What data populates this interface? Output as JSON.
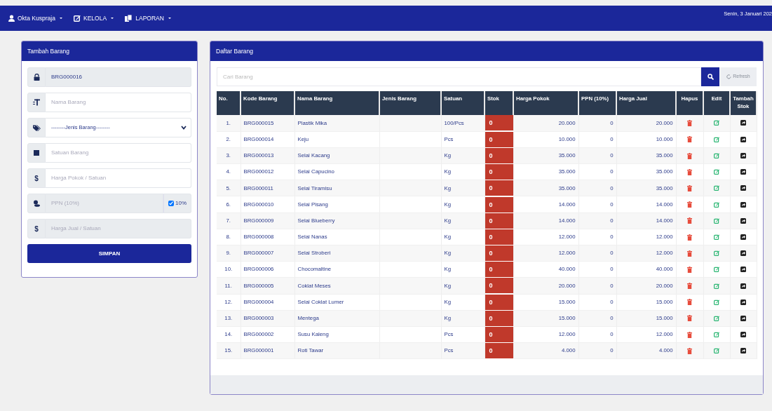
{
  "navbar": {
    "menus": [
      {
        "label": "Okta Kuspraja"
      },
      {
        "label": "KELOLA"
      },
      {
        "label": "LAPORAN"
      }
    ],
    "date": "Senin, 3 Januari 202"
  },
  "form_card": {
    "title": "Tambah Barang",
    "fields": [
      {
        "kind": "text",
        "value": "BRG000016",
        "readonly": true
      },
      {
        "kind": "text",
        "placeholder": "Nama Barang",
        "readonly": false
      },
      {
        "kind": "select",
        "value": "--------Jenis Barang--------"
      },
      {
        "kind": "text",
        "placeholder": "Satuan Barang",
        "readonly": false
      },
      {
        "kind": "text",
        "icon_char": "$",
        "placeholder": "Harga Pokok / Satuan",
        "readonly": false
      },
      {
        "kind": "ppn",
        "placeholder": "PPN (10%)",
        "readonly": true,
        "checked": true,
        "check_label": "10%"
      },
      {
        "kind": "text",
        "icon_char": "$",
        "placeholder": "Harga Jual / Satuan",
        "readonly": true
      }
    ],
    "submit": "SIMPAN"
  },
  "list_card": {
    "title": "Daftar Barang",
    "search": {
      "placeholder": "Cari Barang"
    },
    "refresh": {
      "label": "Refresh",
      "disabled": true
    },
    "table": {
      "columns": [
        "No.",
        "Kode Barang",
        "Nama Barang",
        "Jenis Barang",
        "Satuan",
        "Stok",
        "Harga Pokok",
        "PPN (10%)",
        "Harga Jual",
        "Hapus",
        "Edit",
        "Tambah Stok"
      ],
      "rows": [
        {
          "no": "1.",
          "code": "BRG000015",
          "name": "Plastik Mika",
          "unit": "100/Pcs",
          "stock": "0",
          "price": "20.000",
          "ppn": "0",
          "sell": "20.000"
        },
        {
          "no": "2.",
          "code": "BRG000014",
          "name": "Keju",
          "unit": "Pcs",
          "stock": "0",
          "price": "10.000",
          "ppn": "0",
          "sell": "10.000"
        },
        {
          "no": "3.",
          "code": "BRG000013",
          "name": "Selai Kacang",
          "unit": "Kg",
          "stock": "0",
          "price": "35.000",
          "ppn": "0",
          "sell": "35.000"
        },
        {
          "no": "4.",
          "code": "BRG000012",
          "name": "Selai Capucino",
          "unit": "Kg",
          "stock": "0",
          "price": "35.000",
          "ppn": "0",
          "sell": "35.000"
        },
        {
          "no": "5.",
          "code": "BRG000011",
          "name": "Selai Tiramisu",
          "unit": "Kg",
          "stock": "0",
          "price": "35.000",
          "ppn": "0",
          "sell": "35.000"
        },
        {
          "no": "6.",
          "code": "BRG000010",
          "name": "Selai Pisang",
          "unit": "Kg",
          "stock": "0",
          "price": "14.000",
          "ppn": "0",
          "sell": "14.000"
        },
        {
          "no": "7.",
          "code": "BRG000009",
          "name": "Selai Blueberry",
          "unit": "Kg",
          "stock": "0",
          "price": "14.000",
          "ppn": "0",
          "sell": "14.000"
        },
        {
          "no": "8.",
          "code": "BRG000008",
          "name": "Selai Nanas",
          "unit": "Kg",
          "stock": "0",
          "price": "12.000",
          "ppn": "0",
          "sell": "12.000"
        },
        {
          "no": "9.",
          "code": "BRG000007",
          "name": "Selai Stroberi",
          "unit": "Kg",
          "stock": "0",
          "price": "12.000",
          "ppn": "0",
          "sell": "12.000"
        },
        {
          "no": "10.",
          "code": "BRG000006",
          "name": "Chocomaltine",
          "unit": "Kg",
          "stock": "0",
          "price": "40.000",
          "ppn": "0",
          "sell": "40.000"
        },
        {
          "no": "11.",
          "code": "BRG000005",
          "name": "Coklat Meses",
          "unit": "Kg",
          "stock": "0",
          "price": "20.000",
          "ppn": "0",
          "sell": "20.000"
        },
        {
          "no": "12.",
          "code": "BRG000004",
          "name": "Selai Coklat Lumer",
          "unit": "Kg",
          "stock": "0",
          "price": "15.000",
          "ppn": "0",
          "sell": "15.000"
        },
        {
          "no": "13.",
          "code": "BRG000003",
          "name": "Mentega",
          "unit": "Kg",
          "stock": "0",
          "price": "15.000",
          "ppn": "0",
          "sell": "15.000"
        },
        {
          "no": "14.",
          "code": "BRG000002",
          "name": "Susu Kaleng",
          "unit": "Pcs",
          "stock": "0",
          "price": "12.000",
          "ppn": "0",
          "sell": "12.000"
        },
        {
          "no": "15.",
          "code": "BRG000001",
          "name": "Roti Tawar",
          "unit": "Pcs",
          "stock": "0",
          "price": "4.000",
          "ppn": "0",
          "sell": "4.000"
        }
      ]
    }
  }
}
